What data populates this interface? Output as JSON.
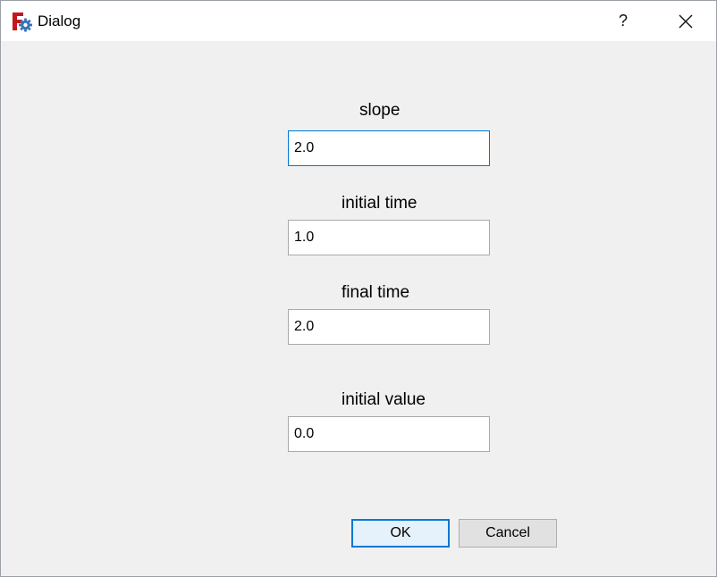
{
  "window": {
    "title": "Dialog",
    "help_label": "?",
    "app_icon": "freecad-icon",
    "close_icon": "close-icon"
  },
  "fields": [
    {
      "label": "slope",
      "value": "2.0",
      "focused": true
    },
    {
      "label": "initial time",
      "value": "1.0"
    },
    {
      "label": "final time",
      "value": "2.0"
    },
    {
      "label": "initial value",
      "value": "0.0"
    }
  ],
  "buttons": {
    "ok_label": "OK",
    "cancel_label": "Cancel"
  },
  "colors": {
    "focus_border": "#0078d7",
    "dialog_background": "#f0f0f0",
    "app_icon_red": "#c4161c",
    "app_icon_blue": "#3b73b9"
  }
}
